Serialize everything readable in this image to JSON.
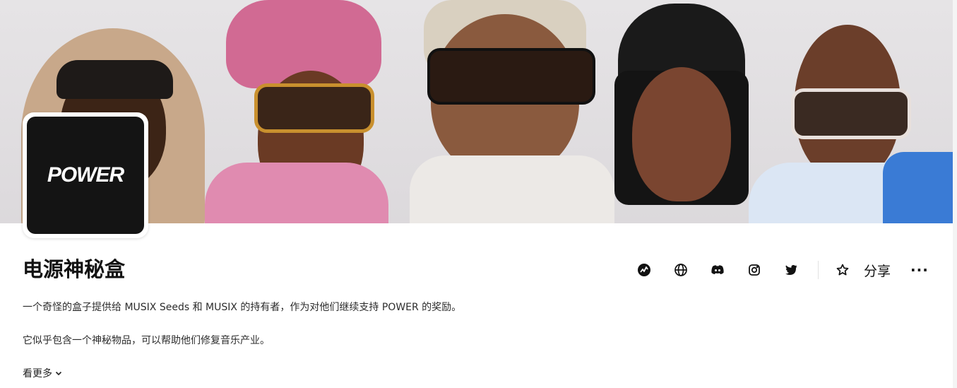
{
  "collection": {
    "logo_text": "POWER",
    "title": "电源神秘盒",
    "description_1": "一个奇怪的盒子提供给 MUSIX Seeds 和 MUSIX 的持有者，作为对他们继续支持 POWER 的奖励。",
    "description_2": "它似乎包含一个神秘物品，可以帮助他们修复音乐产业。",
    "see_more": "看更多"
  },
  "actions": {
    "icons": [
      "activity-icon",
      "globe-icon",
      "discord-icon",
      "instagram-icon",
      "twitter-icon",
      "star-icon"
    ],
    "share_label": "分享",
    "more_label": "···"
  },
  "colors": {
    "background": "#ffffff",
    "text": "#121212",
    "logo_bg": "#141414"
  }
}
